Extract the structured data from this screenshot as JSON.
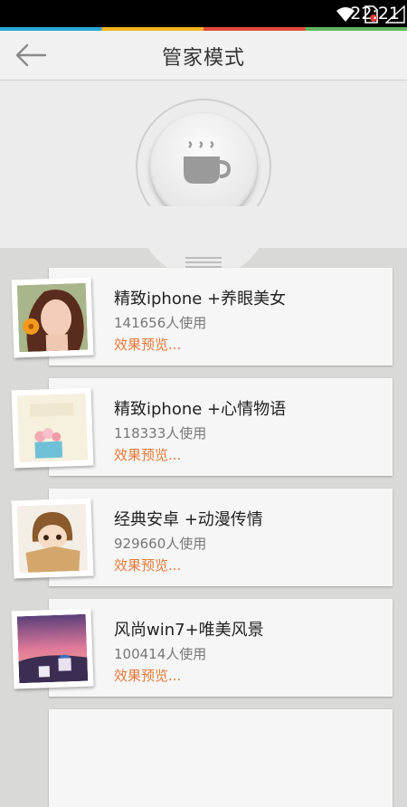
{
  "status_bar": {
    "time": "22:21",
    "icons": [
      "wifi-icon",
      "sim-blocked-icon",
      "signal-icon",
      "battery-icon"
    ]
  },
  "header": {
    "back_icon": "arrow-left-icon",
    "title": "管家模式"
  },
  "hero": {
    "icon": "coffee-cup-icon"
  },
  "themes": [
    {
      "name": "精致iphone +养眼美女",
      "usage": "141656人使用",
      "preview": "效果预览..."
    },
    {
      "name": "精致iphone +心情物语",
      "usage": "118333人使用",
      "preview": "效果预览..."
    },
    {
      "name": "经典安卓 +动漫传情",
      "usage": "929660人使用",
      "preview": "效果预览..."
    },
    {
      "name": "风尚win7+唯美风景",
      "usage": "100414人使用",
      "preview": "效果预览..."
    }
  ],
  "colors": {
    "accent_orange": "#e47a3a",
    "header_bg": "#f1f1f1",
    "page_bg": "#d9d9d7"
  }
}
